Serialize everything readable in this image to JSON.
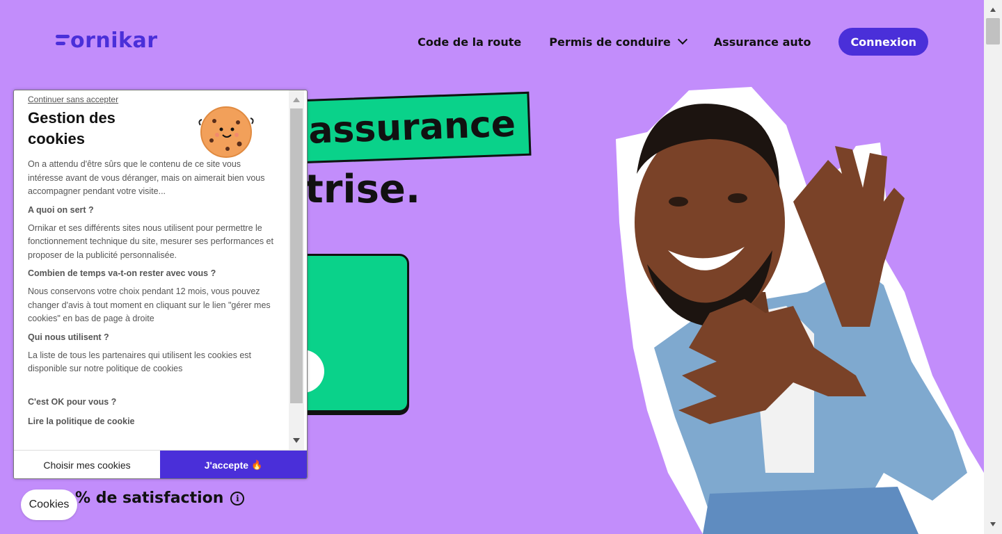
{
  "header": {
    "logo_text": "ornikar",
    "nav": {
      "code_route": "Code de la route",
      "permis": "Permis de conduire",
      "assurance": "Assurance auto",
      "connexion": "Connexion"
    }
  },
  "hero": {
    "tag_text": "assurance",
    "line2": "trise.",
    "satisfaction": "% de satisfaction",
    "info_icon": "i"
  },
  "cookie_modal": {
    "skip_link": "Continuer sans accepter",
    "title": "Gestion des cookies",
    "intro": "On a attendu d'être sûrs que le contenu de ce site vous intéresse avant de vous déranger, mais on aimerait bien vous accompagner pendant votre visite...",
    "q1": "A quoi on sert ?",
    "a1": "Ornikar et ses différents sites nous utilisent pour permettre le fonctionnement technique du site, mesurer ses performances et proposer de la publicité personnalisée.",
    "q2": "Combien de temps va-t-on rester avec vous ?",
    "a2": "Nous conservons votre choix pendant 12 mois, vous pouvez changer d'avis à tout moment en cliquant sur le lien \"gérer mes cookies\" en bas de page à droite",
    "q3": "Qui nous utilisent ?",
    "a3": "La liste de tous les partenaires qui utilisent les cookies est disponible sur notre politique de cookies",
    "q4": "C'est OK pour vous ?",
    "cut_link": "Lire la politique de cookie",
    "btn_choose": "Choisir mes cookies",
    "btn_accept": "J'accepte",
    "accept_emoji": "🔥"
  },
  "cookies_pill": "Cookies",
  "colors": {
    "background": "#c28dfb",
    "brand": "#4a2fd9",
    "green": "#0ad28a"
  },
  "icons": [
    "chevron-down-icon",
    "info-icon",
    "cookie-mascot-icon",
    "flame-icon",
    "scroll-up-icon",
    "scroll-down-icon"
  ]
}
